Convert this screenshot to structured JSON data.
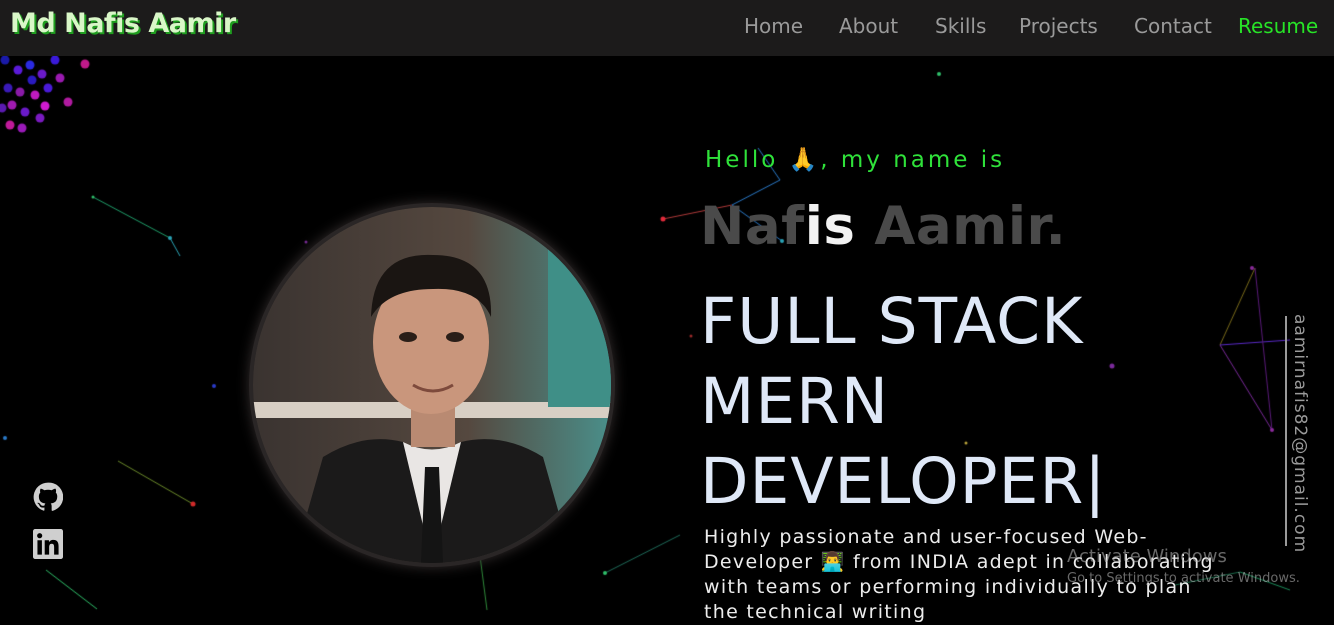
{
  "navbar": {
    "brand": "Md Nafis Aamir",
    "links": [
      "Home",
      "About",
      "Skills",
      "Projects",
      "Contact"
    ],
    "resume_label": "Resume"
  },
  "hero": {
    "greeting": "Hello 🙏, my name is",
    "name_dim_start": "Naf",
    "name_bright": "is",
    "name_dim_end": " Aamir.",
    "role_lines": [
      "FULL STACK",
      "MERN",
      "DEVELOPER|"
    ],
    "bio": "Highly passionate and user-focused Web-Developer 👨‍💻 from INDIA adept in collaborating with teams or performing individually to plan the technical writing"
  },
  "sidebar": {
    "social": [
      "github-icon",
      "linkedin-icon"
    ],
    "email": "aamirnafis82@gmail.com"
  },
  "watermark": {
    "title": "Activate Windows",
    "subtitle": "Go to Settings to activate Windows."
  },
  "colors": {
    "accent_green": "#27e327",
    "greeting_green": "#2fe23a",
    "background": "#000000",
    "navbar": "#1c1b1b"
  }
}
